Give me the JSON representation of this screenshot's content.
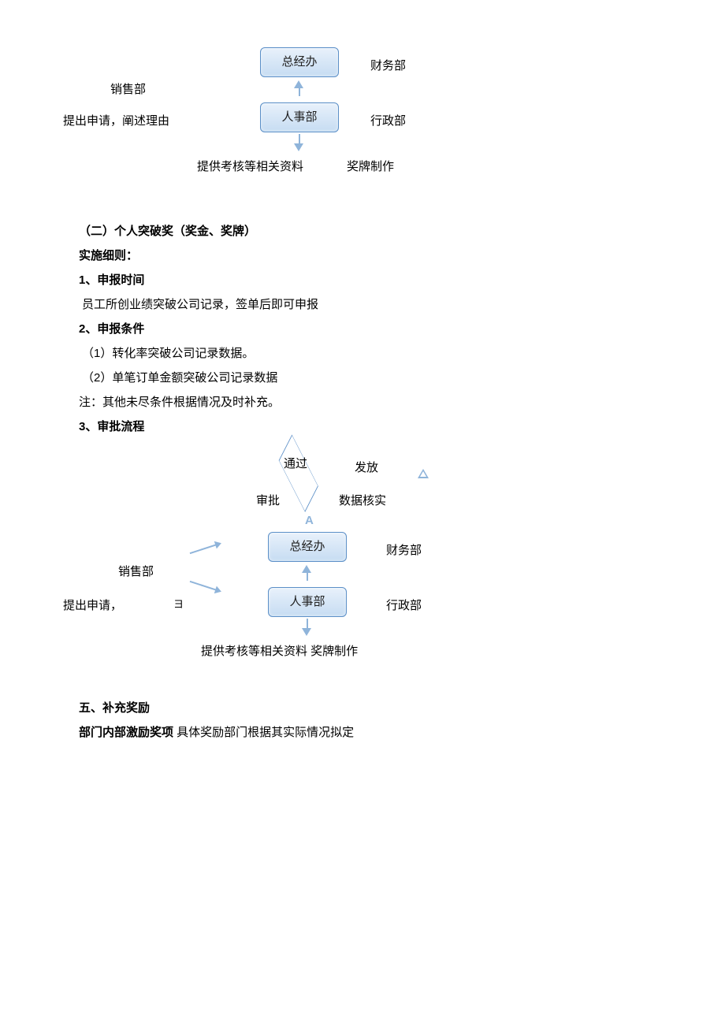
{
  "diagram1": {
    "box_general_office": "总经办",
    "box_hr": "人事部",
    "label_sales": "销售部",
    "label_sales_sub": "提出申请，阐述理由",
    "label_finance": "财务部",
    "label_admin": "行政部",
    "label_provide": "提供考核等相关资料",
    "label_medal": "奖牌制作"
  },
  "section2": {
    "heading": "（二）个人突破奖（奖金、奖牌）",
    "rule_title": "实施细则：",
    "no1_title": "1、申报时间",
    "no1_body": "员工所创业绩突破公司记录，签单后即可申报",
    "no2_title": "2、申报条件",
    "no2_item1": "（1）转化率突破公司记录数据。",
    "no2_item2": "（2）单笔订单金额突破公司记录数据",
    "no2_note": "注：其他未尽条件根据情况及时补充。",
    "no3_title": "3、审批流程"
  },
  "diagram2": {
    "diamond_pass": "通过",
    "label_issue": "发放",
    "label_approve": "审批",
    "label_verify": "数据核实",
    "box_general_office": "总经办",
    "box_hr": "人事部",
    "label_sales": "销售部",
    "label_sales_sub_left": "提出申请，",
    "label_sales_sub_right": "ヨ",
    "label_finance": "财务部",
    "label_admin": "行政部",
    "label_bottom": "提供考核等相关资料 奖牌制作"
  },
  "section5": {
    "title": "五、补充奖励",
    "line": "部门内部激励奖项 具体奖励部门根据其实际情况拟定",
    "line_bold": "部门内部激励奖项",
    "line_rest": " 具体奖励部门根据其实际情况拟定"
  }
}
